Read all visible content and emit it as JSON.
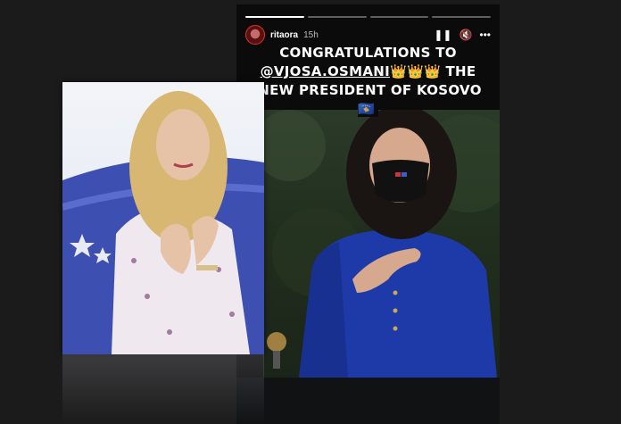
{
  "story": {
    "username": "ritaora",
    "time": "15h",
    "progress": {
      "segments": 4,
      "completed": 1
    },
    "caption": {
      "line1": "CONGRATULATIONS TO",
      "line2_mention": "@VJOSA.OSMANI",
      "line2_emoji": "👑👑👑",
      "line2_rest": " THE",
      "line3": "NEW PRESIDENT OF KOSOVO",
      "line3_flag": "🇽🇰"
    },
    "controls": {
      "pause_icon": "pause-icon",
      "mute_icon": "mute-icon",
      "more_icon": "more-icon"
    }
  },
  "colors": {
    "background": "#1b1b1b",
    "story_bg": "#0b0b0b",
    "accent_red": "#dd3333",
    "blazer_blue": "#1e3aa8"
  }
}
